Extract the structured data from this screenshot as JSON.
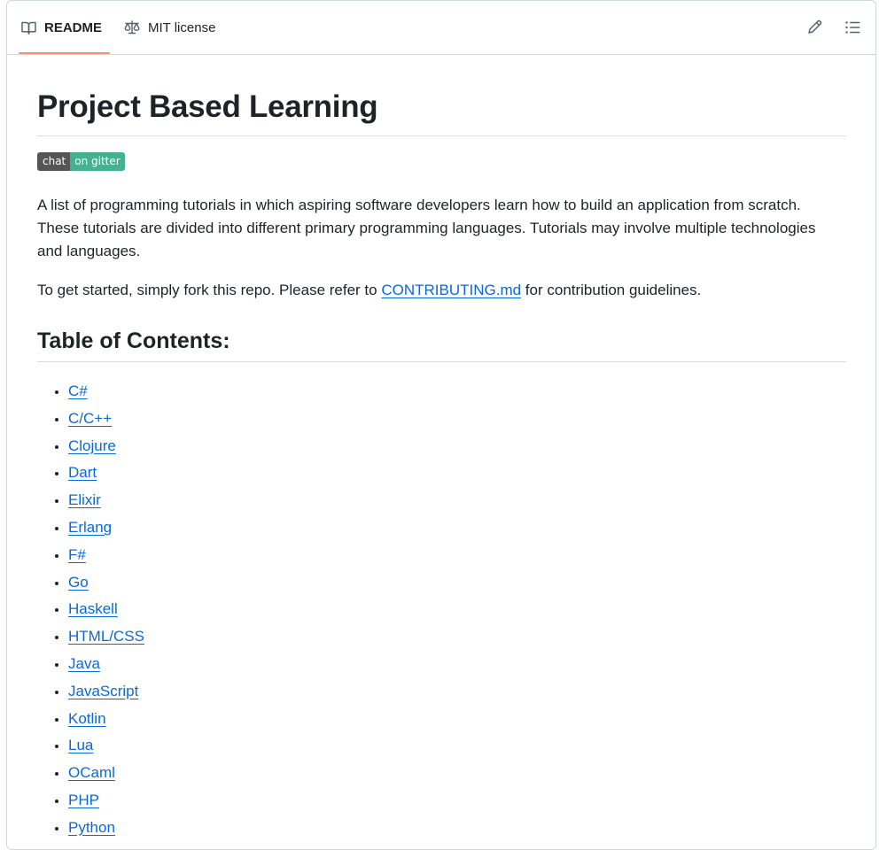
{
  "tabs": [
    {
      "label": "README",
      "icon": "book-icon",
      "active": true
    },
    {
      "label": "MIT license",
      "icon": "scale-icon",
      "active": false
    }
  ],
  "toolbar": {
    "edit_icon": "pencil-icon",
    "toc_icon": "list-unordered-icon"
  },
  "readme": {
    "title": "Project Based Learning",
    "badge": {
      "left": "chat",
      "right": "on gitter"
    },
    "intro": "A list of programming tutorials in which aspiring software developers learn how to build an application from scratch. These tutorials are divided into different primary programming languages. Tutorials may involve multiple technologies and languages.",
    "getting_started": {
      "before": "To get started, simply fork this repo. Please refer to ",
      "link": "CONTRIBUTING.md",
      "after": " for contribution guidelines."
    },
    "toc_heading": "Table of Contents:",
    "toc_items": [
      "C#",
      "C/C++",
      "Clojure",
      "Dart",
      "Elixir",
      "Erlang",
      "F#",
      "Go",
      "Haskell",
      "HTML/CSS",
      "Java",
      "JavaScript",
      "Kotlin",
      "Lua",
      "OCaml",
      "PHP",
      "Python"
    ]
  },
  "colors": {
    "accent_underline": "#fd8c73",
    "link": "#0969da",
    "badge_left": "#555555",
    "badge_right": "#44b28f",
    "border": "#d0d7de"
  }
}
